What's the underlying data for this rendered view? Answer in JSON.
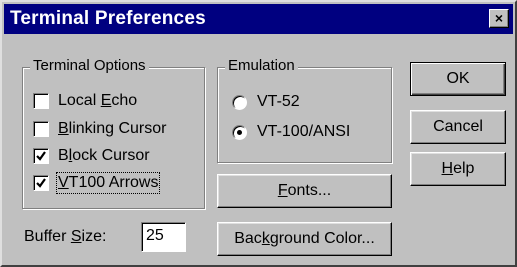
{
  "window": {
    "title": "Terminal Preferences",
    "close_glyph": "×"
  },
  "terminal_options": {
    "legend": "Terminal Options",
    "items": [
      {
        "pre": "Local ",
        "key": "E",
        "post": "cho",
        "checked": false
      },
      {
        "pre": "",
        "key": "B",
        "post": "linking Cursor",
        "checked": false
      },
      {
        "pre": "B",
        "key": "l",
        "post": "ock Cursor",
        "checked": true
      },
      {
        "pre": "",
        "key": "V",
        "post": "T100 Arrows",
        "checked": true
      }
    ]
  },
  "emulation": {
    "legend": "Emulation",
    "options": [
      {
        "label": "VT-52",
        "selected": false
      },
      {
        "label": "VT-100/ANSI",
        "selected": true
      }
    ]
  },
  "buttons": {
    "ok": "OK",
    "cancel": "Cancel",
    "help": {
      "key": "H",
      "post": "elp"
    },
    "fonts": {
      "key": "F",
      "post": "onts..."
    },
    "background": {
      "pre": "Bac",
      "key": "k",
      "post": "ground Color..."
    }
  },
  "buffer": {
    "pre": "Buffer ",
    "key": "S",
    "post": "ize:",
    "value": "25"
  }
}
